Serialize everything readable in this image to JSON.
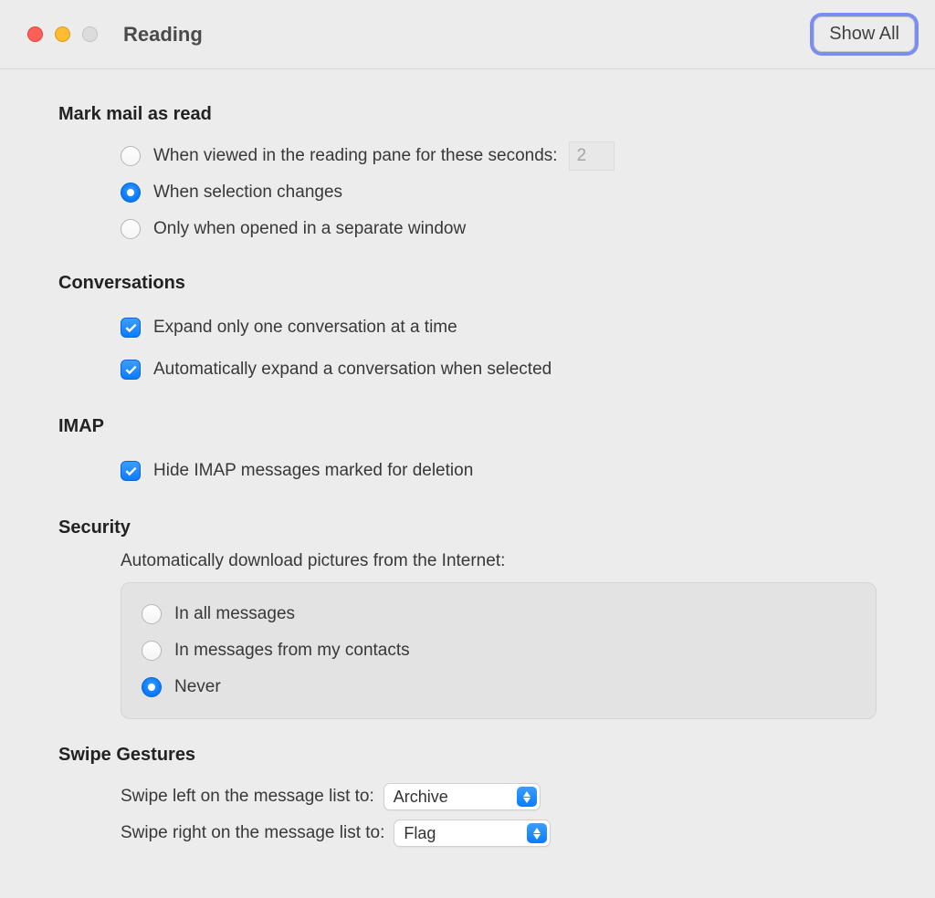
{
  "titlebar": {
    "title": "Reading",
    "show_all": "Show All"
  },
  "sections": {
    "mark_read": {
      "heading": "Mark mail as read",
      "opt_viewed": "When viewed in the reading pane for these seconds:",
      "seconds_value": "2",
      "opt_selection": "When selection changes",
      "opt_separate": "Only when opened in a separate window",
      "selected": "selection"
    },
    "conversations": {
      "heading": "Conversations",
      "expand_one": "Expand only one conversation at a time",
      "auto_expand": "Automatically expand a conversation when selected"
    },
    "imap": {
      "heading": "IMAP",
      "hide_deleted": "Hide IMAP messages marked for deletion"
    },
    "security": {
      "heading": "Security",
      "auto_dl_label": "Automatically download pictures from the Internet:",
      "opt_all": "In all messages",
      "opt_contacts": "In messages from my contacts",
      "opt_never": "Never",
      "selected": "never"
    },
    "swipe": {
      "heading": "Swipe Gestures",
      "left_label": "Swipe left on the message list to:",
      "left_value": "Archive",
      "right_label": "Swipe right on the message list to:",
      "right_value": "Flag"
    }
  }
}
